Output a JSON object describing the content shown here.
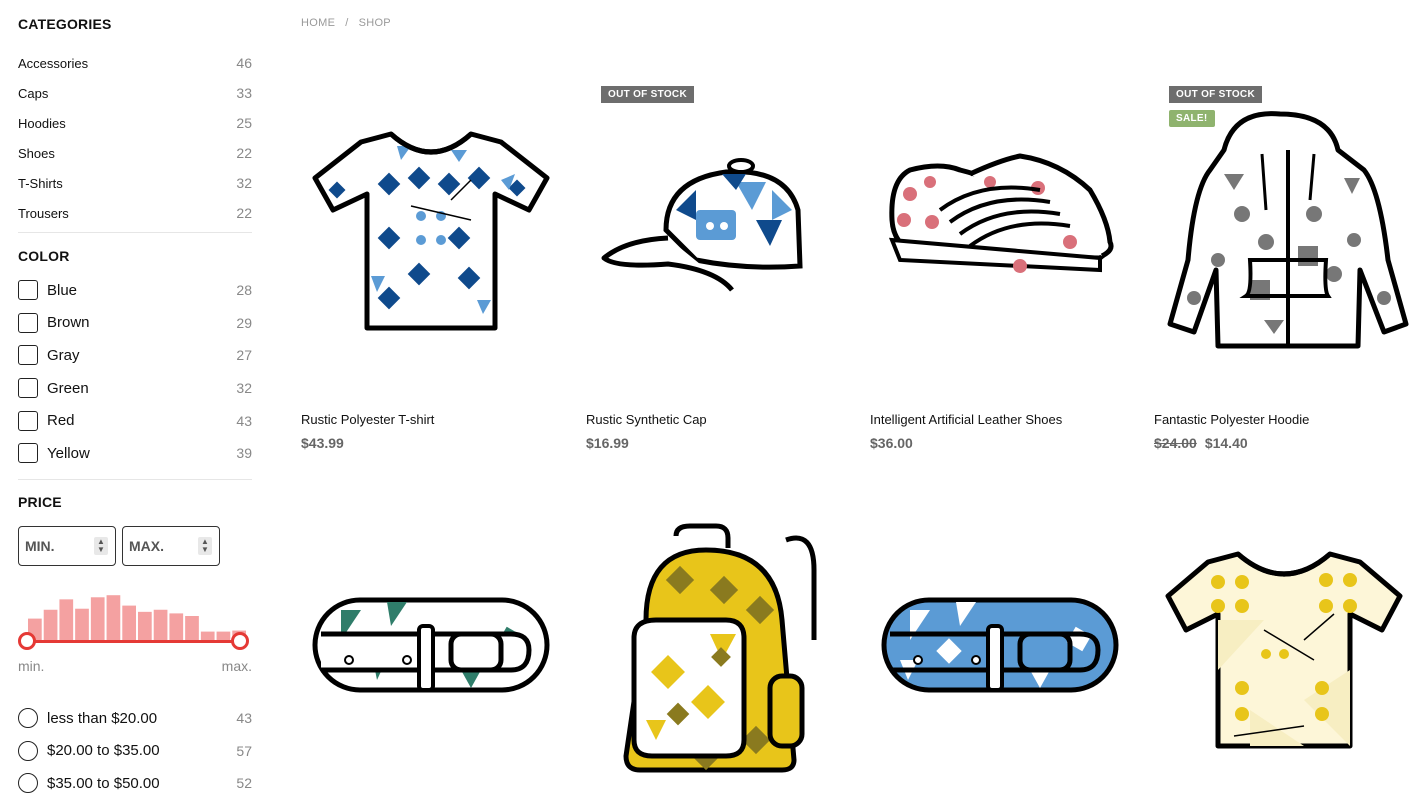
{
  "breadcrumb": {
    "home": "HOME",
    "sep": "/",
    "current": "SHOP"
  },
  "sidebar": {
    "categories_title": "CATEGORIES",
    "categories": [
      {
        "name": "Accessories",
        "count": "46"
      },
      {
        "name": "Caps",
        "count": "33"
      },
      {
        "name": "Hoodies",
        "count": "25"
      },
      {
        "name": "Shoes",
        "count": "22"
      },
      {
        "name": "T-Shirts",
        "count": "32"
      },
      {
        "name": "Trousers",
        "count": "22"
      }
    ],
    "color_title": "COLOR",
    "colors": [
      {
        "name": "Blue",
        "count": "28"
      },
      {
        "name": "Brown",
        "count": "29"
      },
      {
        "name": "Gray",
        "count": "27"
      },
      {
        "name": "Green",
        "count": "32"
      },
      {
        "name": "Red",
        "count": "43"
      },
      {
        "name": "Yellow",
        "count": "39"
      }
    ],
    "price_title": "PRICE",
    "min_placeholder": "MIN.",
    "max_placeholder": "MAX.",
    "histogram": [
      0.45,
      0.62,
      0.82,
      0.64,
      0.86,
      0.9,
      0.7,
      0.58,
      0.62,
      0.55,
      0.5,
      0.2,
      0.2,
      0.22
    ],
    "slider_min_label": "min.",
    "slider_max_label": "max.",
    "ranges": [
      {
        "label": "less than $20.00",
        "count": "43"
      },
      {
        "label": "$20.00 to $35.00",
        "count": "57"
      },
      {
        "label": "$35.00 to $50.00",
        "count": "52"
      }
    ]
  },
  "products": [
    {
      "name": "Rustic Polyester T-shirt",
      "price": "$43.99"
    },
    {
      "name": "Rustic Synthetic Cap",
      "price": "$16.99",
      "badge": "OUT OF STOCK"
    },
    {
      "name": "Intelligent Artificial Leather Shoes",
      "price": "$36.00"
    },
    {
      "name": "Fantastic Polyester Hoodie",
      "old_price": "$24.00",
      "price": "$14.40",
      "badge": "OUT OF STOCK",
      "sale_badge": "SALE!"
    }
  ],
  "colors": {
    "accent": "#e53935",
    "histogram": "#f4a1a1",
    "oos_badge": "#6d6d6d",
    "sale_badge": "#8fb36e"
  }
}
